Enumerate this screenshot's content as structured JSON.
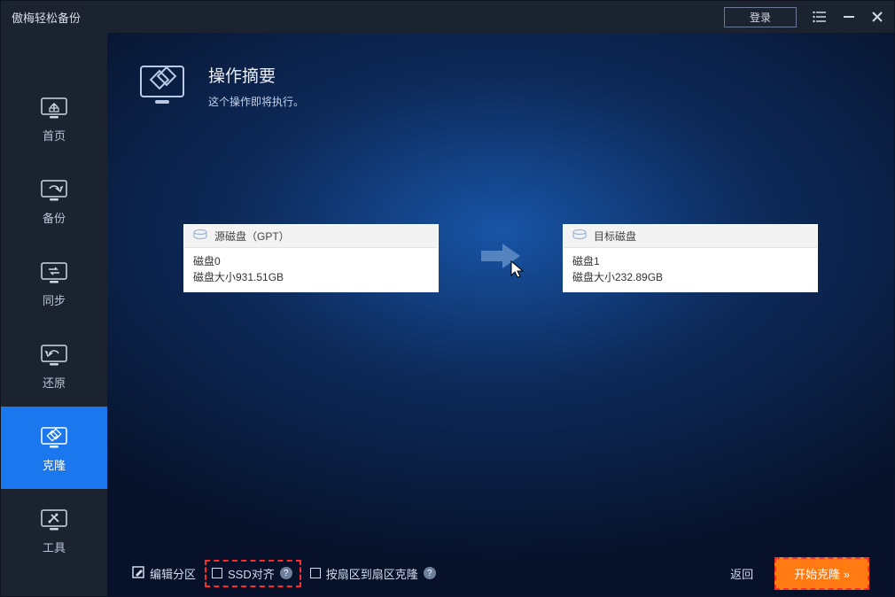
{
  "titlebar": {
    "app_name": "傲梅轻松备份",
    "login_label": "登录"
  },
  "sidebar": {
    "items": [
      {
        "label": "首页"
      },
      {
        "label": "备份"
      },
      {
        "label": "同步"
      },
      {
        "label": "还原"
      },
      {
        "label": "克隆"
      },
      {
        "label": "工具"
      }
    ]
  },
  "header": {
    "title": "操作摘要",
    "subtitle": "这个操作即将执行。"
  },
  "source_disk": {
    "title": "源磁盘（GPT）",
    "name": "磁盘0",
    "size_label": "磁盘大小931.51GB"
  },
  "target_disk": {
    "title": "目标磁盘",
    "name": "磁盘1",
    "size_label": "磁盘大小232.89GB"
  },
  "footer": {
    "edit_partition_label": "编辑分区",
    "ssd_align_label": "SSD对齐",
    "sector_clone_label": "按扇区到扇区克隆",
    "back_label": "返回",
    "start_label": "开始克隆 »"
  }
}
